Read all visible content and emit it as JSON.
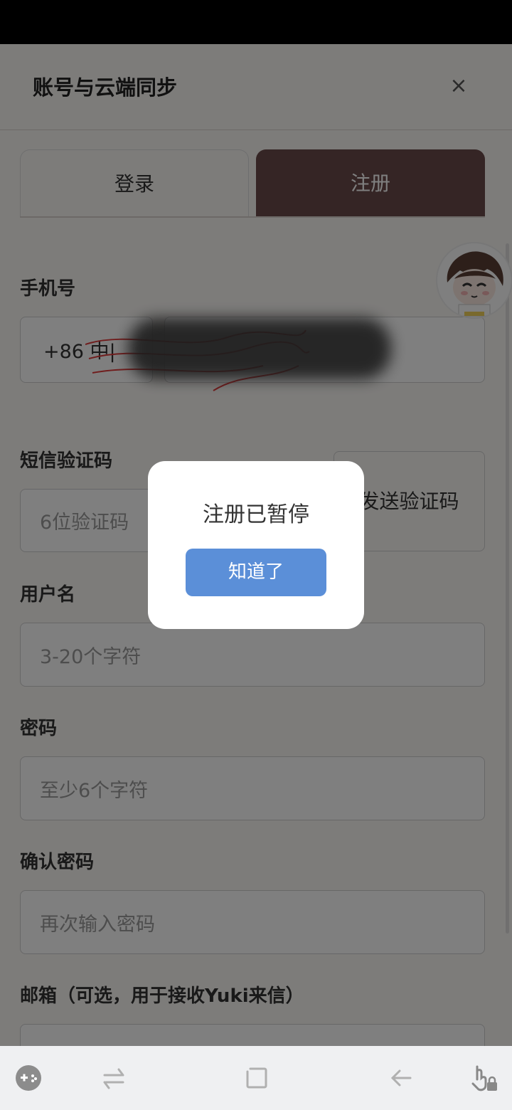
{
  "header": {
    "title": "账号与云端同步",
    "close_label": "×"
  },
  "tabs": [
    {
      "label": "登录",
      "active": false
    },
    {
      "label": "注册",
      "active": true
    }
  ],
  "form": {
    "phone": {
      "label": "手机号",
      "country_code": "+86 中|"
    },
    "sms": {
      "label": "短信验证码",
      "placeholder": "6位验证码",
      "send_button": "发送验证码"
    },
    "username": {
      "label": "用户名",
      "placeholder": "3-20个字符"
    },
    "password": {
      "label": "密码",
      "placeholder": "至少6个字符"
    },
    "confirm": {
      "label": "确认密码",
      "placeholder": "再次输入密码"
    },
    "email": {
      "label": "邮箱（可选，用于接收Yuki来信）"
    }
  },
  "dialog": {
    "message": "注册已暂停",
    "button": "知道了"
  },
  "nav": {
    "icons": [
      "gamepad-icon",
      "switch-icon",
      "square-icon",
      "back-arrow-icon",
      "touch-lock-icon"
    ]
  },
  "colors": {
    "accent_tab": "#6b4a4a",
    "dialog_button": "#5b8fd8"
  }
}
